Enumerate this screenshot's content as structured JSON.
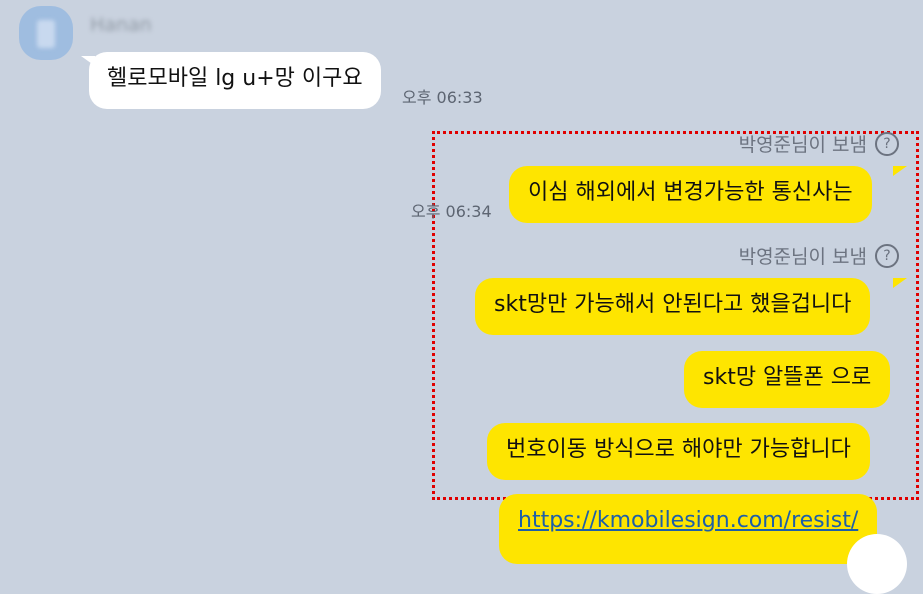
{
  "incoming": {
    "sender_name": "Hanan",
    "message": "헬로모바일 lg u+망 이구요",
    "time": "오후 06:33"
  },
  "outgoing": {
    "sent_label": "박영준님이 보냄",
    "help_glyph": "?",
    "time": "오후 06:34",
    "messages": [
      "이심 해외에서 변경가능한 통신사는",
      "skt망만 가능해서 안된다고 했을겁니다",
      "skt망 알뜰폰 으로",
      "번호이동 방식으로 해야만 가능합니다"
    ],
    "link": "https://kmobilesign.com/resist/"
  },
  "colors": {
    "background": "#c9d2df",
    "outgoing_bubble": "#fee500",
    "incoming_bubble": "#ffffff",
    "selection_box": "#e00000",
    "link": "#1d5fa8"
  }
}
